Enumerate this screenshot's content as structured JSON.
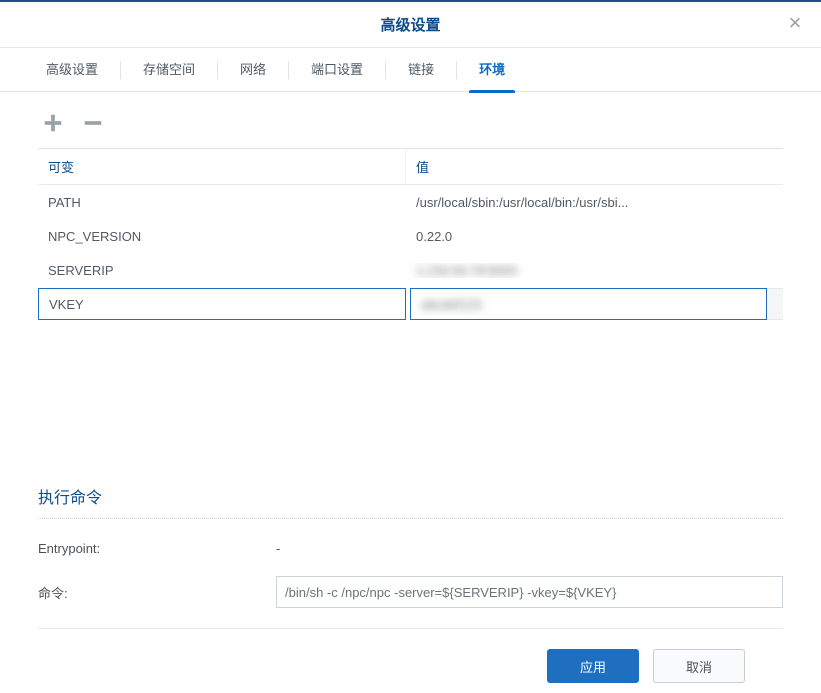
{
  "dialog": {
    "title": "高级设置"
  },
  "tabs": {
    "items": [
      {
        "label": "高级设置"
      },
      {
        "label": "存储空间"
      },
      {
        "label": "网络"
      },
      {
        "label": "端口设置"
      },
      {
        "label": "链接"
      },
      {
        "label": "环境"
      }
    ],
    "active_index": 5
  },
  "toolbar": {
    "add_label": "+",
    "remove_label": "−"
  },
  "env_table": {
    "headers": {
      "name": "可变",
      "value": "值"
    },
    "rows": [
      {
        "name": "PATH",
        "value": "/usr/local/sbin:/usr/local/bin:/usr/sbi...",
        "redacted": false
      },
      {
        "name": "NPC_VERSION",
        "value": "0.22.0",
        "redacted": false
      },
      {
        "name": "SERVERIP",
        "value": "1.234.56.78:9000",
        "redacted": true
      },
      {
        "name": "VKEY",
        "value": "abcdef123",
        "redacted": true
      }
    ],
    "selected_index": 3
  },
  "exec": {
    "title": "执行命令",
    "entrypoint_label": "Entrypoint:",
    "entrypoint_value": "-",
    "command_label": "命令:",
    "command_value": "/bin/sh -c /npc/npc -server=${SERVERIP} -vkey=${VKEY}"
  },
  "footer": {
    "apply": "应用",
    "cancel": "取消"
  }
}
